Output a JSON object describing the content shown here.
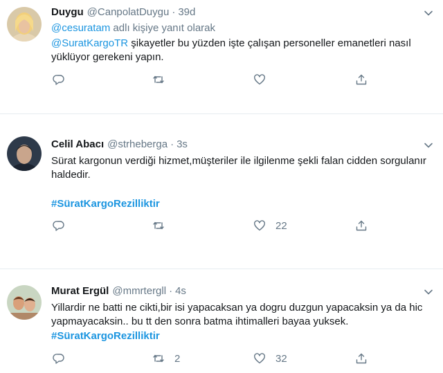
{
  "tweets": [
    {
      "name": "Duygu",
      "handle": "@CanpolatDuygu",
      "separator": "·",
      "time": "39d",
      "reply_to_handle": "@cesuratam",
      "reply_to_suffix": " adlı kişiye yanıt olarak",
      "mention": "@SuratKargoTR",
      "text": " şikayetler bu yüzden işte çalışan personeller emanetleri nasıl yüklüyor gerekeni yapın.",
      "reply_count": "",
      "retweet_count": "",
      "like_count": ""
    },
    {
      "name": "Celil Abacı",
      "handle": "@strheberga",
      "separator": "·",
      "time": "3s",
      "text": "Sürat kargonun verdiği hizmet,müşteriler ile ilgilenme şekli falan cidden sorgulanır haldedir.",
      "hashtag": "#SüratKargoRezilliktir",
      "reply_count": "",
      "retweet_count": "",
      "like_count": "22"
    },
    {
      "name": "Murat Ergül",
      "handle": "@mmrtergll",
      "separator": "·",
      "time": "4s",
      "text": "Yillardir ne batti ne cikti,bir isi yapacaksan ya dogru duzgun yapacaksin ya da hic yapmayacaksin.. bu tt den sonra batma ihtimalleri bayaa yuksek.",
      "hashtag": "#SüratKargoRezilliktir",
      "reply_count": "",
      "retweet_count": "2",
      "like_count": "32"
    }
  ],
  "icons": {
    "reply": "reply-icon",
    "retweet": "retweet-icon",
    "like": "heart-icon",
    "share": "share-icon",
    "more": "chevron-down-icon"
  },
  "colors": {
    "link": "#1b95e0",
    "secondary_text": "#657786",
    "divider": "#e6ecf0"
  }
}
